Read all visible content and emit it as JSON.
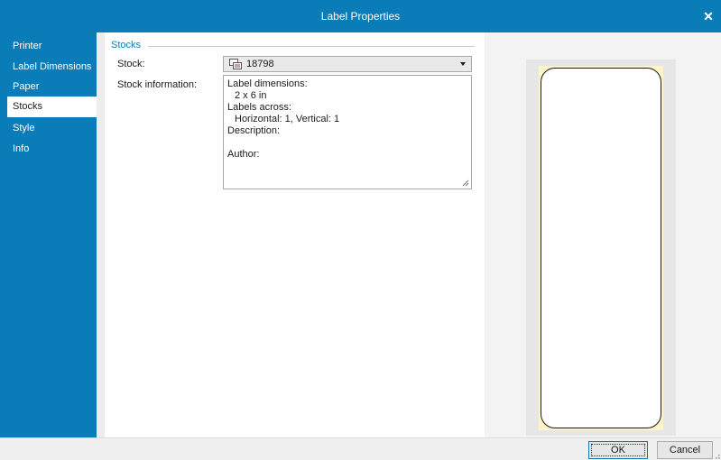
{
  "window": {
    "title": "Label Properties",
    "close_glyph": "✕"
  },
  "sidebar": {
    "items": [
      {
        "label": "Printer"
      },
      {
        "label": "Label Dimensions"
      },
      {
        "label": "Paper"
      },
      {
        "label": "Stocks",
        "active": true
      },
      {
        "label": "Style"
      },
      {
        "label": "Info"
      }
    ]
  },
  "stocks": {
    "section_title": "Stocks",
    "stock_label": "Stock:",
    "stock_value": "18798",
    "stock_icon": "label-stock-icon",
    "info_label": "Stock information:",
    "info_lines": [
      {
        "text": "Label dimensions:"
      },
      {
        "text": "2 x 6 in"
      },
      {
        "text": "Labels across:"
      },
      {
        "text": "Horizontal: 1, Vertical: 1"
      },
      {
        "text": "Description:"
      },
      {
        "text": ""
      },
      {
        "text": "Author:"
      }
    ]
  },
  "footer": {
    "ok_label": "OK",
    "cancel_label": "Cancel"
  },
  "colors": {
    "accent": "#0a7db8",
    "label_sheet": "#fdf3c8"
  }
}
